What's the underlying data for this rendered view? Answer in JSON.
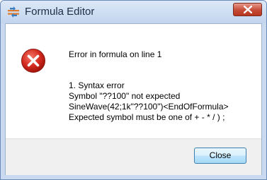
{
  "window": {
    "title": "Formula Editor",
    "icon": "formula-editor-icon",
    "close_icon": "close-icon"
  },
  "message": {
    "icon": "error-icon",
    "heading": "Error in formula on line 1",
    "lines": [
      "1. Syntax error",
      "Symbol \"??100\" not expected",
      "SineWave(42;1k\"??100\")<EndOfFormula>",
      "Expected symbol must be one of + - * / ) ;"
    ]
  },
  "buttons": {
    "close_label": "Close"
  },
  "colors": {
    "titlebar": "#c9daf0",
    "close_button": "#c44b36",
    "error_icon": "#d42a1f",
    "footer": "#f0f0f0"
  }
}
